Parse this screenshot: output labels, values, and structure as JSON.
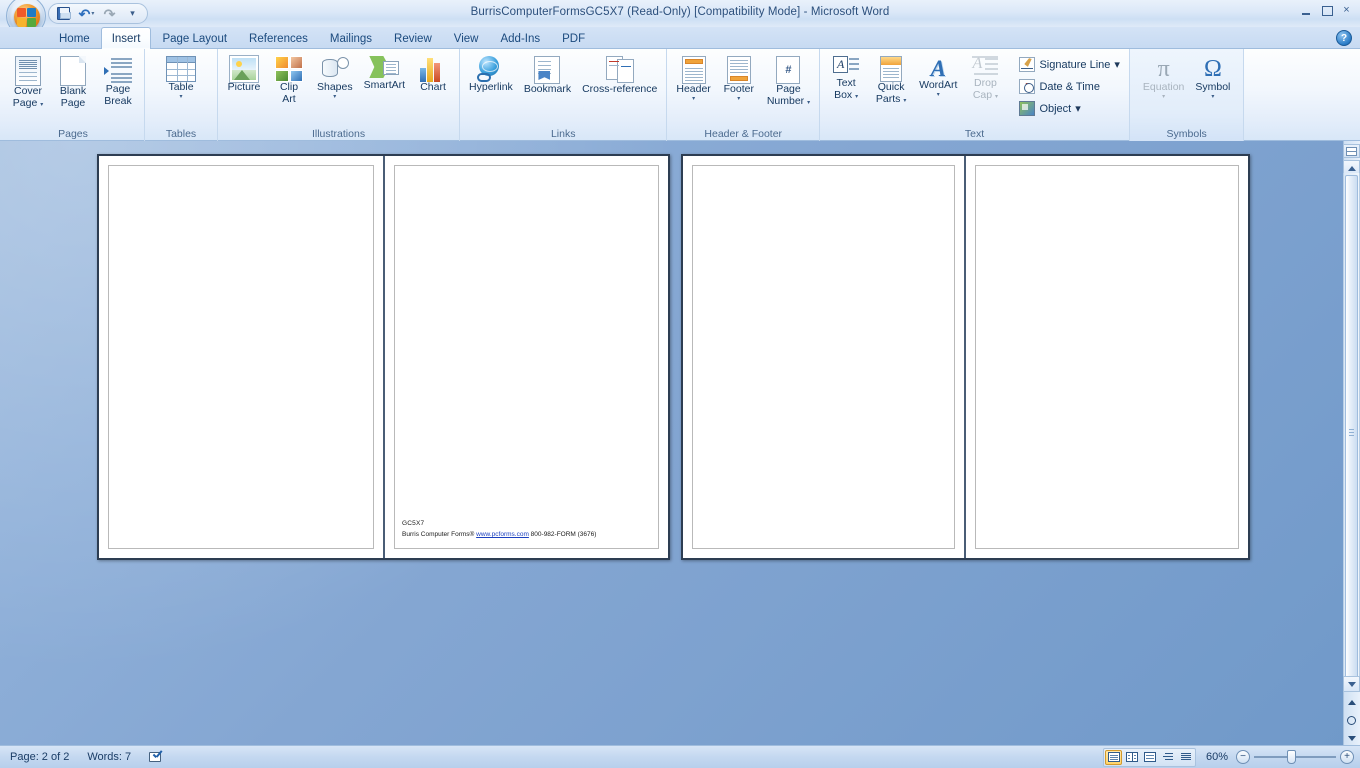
{
  "window": {
    "title": "BurrisComputerFormsGC5X7 (Read-Only) [Compatibility Mode] - Microsoft Word",
    "minimize_label": "Minimize",
    "restore_label": "Restore Down",
    "close_label": "×"
  },
  "office_button": {
    "name": "Office Button"
  },
  "quick_access": {
    "items": [
      {
        "name": "save",
        "label": "Save",
        "icon": "save-icon"
      },
      {
        "name": "undo",
        "label": "Undo",
        "icon": "undo-icon",
        "caret": "▾"
      },
      {
        "name": "redo",
        "label": "Redo",
        "icon": "redo-icon",
        "disabled": true
      },
      {
        "name": "customize",
        "label": "Customize Quick Access Toolbar",
        "icon": "chevron-down-icon"
      }
    ],
    "customize_glyph": "‹"
  },
  "tabs": [
    {
      "label": "Home",
      "active": false
    },
    {
      "label": "Insert",
      "active": true
    },
    {
      "label": "Page Layout",
      "active": false
    },
    {
      "label": "References",
      "active": false
    },
    {
      "label": "Mailings",
      "active": false
    },
    {
      "label": "Review",
      "active": false
    },
    {
      "label": "View",
      "active": false
    },
    {
      "label": "Add-Ins",
      "active": false
    },
    {
      "label": "PDF",
      "active": false
    }
  ],
  "help": {
    "label": "?"
  },
  "ribbon": {
    "groups": [
      {
        "name": "pages",
        "label": "Pages",
        "buttons": [
          {
            "name": "cover-page",
            "line1": "Cover",
            "line2": "Page",
            "caret": "▾",
            "disabled": false
          },
          {
            "name": "blank-page",
            "line1": "Blank",
            "line2": "Page",
            "caret": "",
            "disabled": false
          },
          {
            "name": "page-break",
            "line1": "Page",
            "line2": "Break",
            "caret": "",
            "disabled": false
          }
        ]
      },
      {
        "name": "tables",
        "label": "Tables",
        "buttons": [
          {
            "name": "table",
            "line1": "Table",
            "line2": "",
            "caret": "▾",
            "disabled": false
          }
        ]
      },
      {
        "name": "illustrations",
        "label": "Illustrations",
        "buttons": [
          {
            "name": "picture",
            "line1": "Picture",
            "line2": "",
            "caret": "",
            "disabled": false
          },
          {
            "name": "clip-art",
            "line1": "Clip",
            "line2": "Art",
            "caret": "",
            "disabled": false
          },
          {
            "name": "shapes",
            "line1": "Shapes",
            "line2": "",
            "caret": "▾",
            "disabled": false
          },
          {
            "name": "smartart",
            "line1": "SmartArt",
            "line2": "",
            "caret": "",
            "disabled": false
          },
          {
            "name": "chart",
            "line1": "Chart",
            "line2": "",
            "caret": "",
            "disabled": false
          }
        ]
      },
      {
        "name": "links",
        "label": "Links",
        "buttons": [
          {
            "name": "hyperlink",
            "line1": "Hyperlink",
            "line2": "",
            "caret": "",
            "disabled": false
          },
          {
            "name": "bookmark",
            "line1": "Bookmark",
            "line2": "",
            "caret": "",
            "disabled": false
          },
          {
            "name": "cross-reference",
            "line1": "Cross-reference",
            "line2": "",
            "caret": "",
            "disabled": false
          }
        ]
      },
      {
        "name": "header-footer",
        "label": "Header & Footer",
        "buttons": [
          {
            "name": "header",
            "line1": "Header",
            "line2": "",
            "caret": "▾",
            "disabled": false
          },
          {
            "name": "footer",
            "line1": "Footer",
            "line2": "",
            "caret": "▾",
            "disabled": false
          },
          {
            "name": "page-number",
            "line1": "Page",
            "line2": "Number",
            "caret": "▾",
            "disabled": false
          }
        ]
      },
      {
        "name": "text",
        "label": "Text",
        "buttons": [
          {
            "name": "text-box",
            "line1": "Text",
            "line2": "Box",
            "caret": "▾",
            "disabled": false
          },
          {
            "name": "quick-parts",
            "line1": "Quick",
            "line2": "Parts",
            "caret": "▾",
            "disabled": false
          },
          {
            "name": "wordart",
            "line1": "WordArt",
            "line2": "",
            "caret": "▾",
            "disabled": false
          },
          {
            "name": "drop-cap",
            "line1": "Drop",
            "line2": "Cap",
            "caret": "▾",
            "disabled": true
          }
        ],
        "small_buttons": [
          {
            "name": "signature-line",
            "label": "Signature Line",
            "caret": "▾"
          },
          {
            "name": "date-time",
            "label": "Date & Time",
            "caret": ""
          },
          {
            "name": "object",
            "label": "Object",
            "caret": "▾"
          }
        ]
      },
      {
        "name": "symbols",
        "label": "Symbols",
        "buttons": [
          {
            "name": "equation",
            "line1": "Equation",
            "line2": "",
            "caret": "▾",
            "disabled": true,
            "glyph": "π"
          },
          {
            "name": "symbol",
            "line1": "Symbol",
            "line2": "",
            "caret": "▾",
            "disabled": false,
            "glyph": "Ω"
          }
        ]
      }
    ]
  },
  "document": {
    "footer": {
      "code": "GC5X7",
      "prefix": "Burris Computer Forms® ",
      "link": "www.pcforms.com",
      "suffix": " 800-982-FORM (3676)"
    },
    "pages": [
      {
        "name": "page-1-left"
      },
      {
        "name": "page-1-right"
      },
      {
        "name": "page-2-left"
      },
      {
        "name": "page-2-right"
      }
    ]
  },
  "status_bar": {
    "page_label": "Page: 2 of 2",
    "words_label": "Words: 7",
    "proofing_label": "Proofing errors",
    "views": [
      {
        "name": "print-layout",
        "label": "Print Layout",
        "active": true
      },
      {
        "name": "full-screen-reading",
        "label": "Full Screen Reading",
        "active": false
      },
      {
        "name": "web-layout",
        "label": "Web Layout",
        "active": false
      },
      {
        "name": "outline",
        "label": "Outline",
        "active": false
      },
      {
        "name": "draft",
        "label": "Draft",
        "active": false
      }
    ],
    "zoom_percent": "60%",
    "zoom_out_label": "−",
    "zoom_in_label": "+"
  },
  "colors": {
    "accent": "#2f6fb5",
    "ribbon_bg": "#f2f7fd",
    "doc_bg": "#7ba0ce",
    "tab_active": "#ffffff",
    "link": "#1a3fbf"
  }
}
